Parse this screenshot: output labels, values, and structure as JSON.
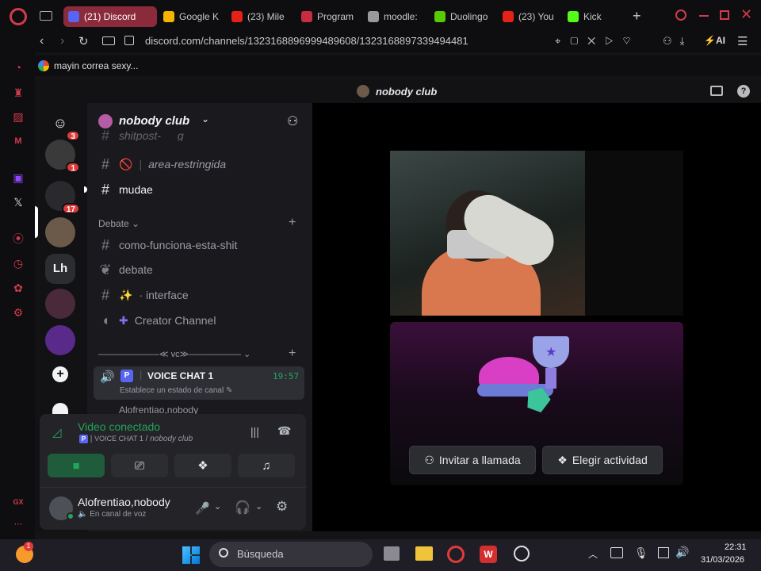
{
  "browser": {
    "tabs": [
      {
        "label": "(21) Discord",
        "icon": "discord-icon",
        "color": "#5865f2",
        "active": true
      },
      {
        "label": "Google K",
        "icon": "keep-icon",
        "color": "#f4b400",
        "active": false
      },
      {
        "label": "(23) Mile",
        "icon": "youtube-icon",
        "color": "#e62117",
        "active": false
      },
      {
        "label": "Program",
        "icon": "opera-icon",
        "color": "#c72c41",
        "active": false
      },
      {
        "label": "moodle:",
        "icon": "moodle-icon",
        "color": "#999999",
        "active": false
      },
      {
        "label": "Duolingo",
        "icon": "duolingo-icon",
        "color": "#58cc02",
        "active": false
      },
      {
        "label": "(23) You",
        "icon": "youtube-icon",
        "color": "#e62117",
        "active": false
      },
      {
        "label": "Kick",
        "icon": "kick-icon",
        "color": "#53fc18",
        "active": false
      }
    ],
    "url": "discord.com/channels/1323168896999489608/1323168897339494481",
    "bookmark": "mayin correa sexy...",
    "ai_label": "AI"
  },
  "discord": {
    "header_title": "nobody club",
    "server_name": "nobody club",
    "servers": [
      {
        "name": "discord-home",
        "badge": "3",
        "color": "#5865f2",
        "text": ""
      },
      {
        "name": "server-avatar-1",
        "badge": "1",
        "color": "#3a3a3a",
        "text": ""
      },
      {
        "name": "server-avatar-2",
        "badge": "17",
        "color": "#2a2a2e",
        "text": ""
      },
      {
        "name": "server-avatar-3",
        "badge": "",
        "color": "#6b5a4a",
        "text": ""
      },
      {
        "name": "server-lh",
        "badge": "",
        "color": "#2b2d31",
        "text": "Lh"
      },
      {
        "name": "server-avatar-5",
        "badge": "",
        "color": "#4a2a3a",
        "text": ""
      },
      {
        "name": "server-avatar-6",
        "badge": "",
        "color": "#5a2a8a",
        "text": ""
      }
    ],
    "channels": {
      "partial_top": "shitpost-゚ﾟg",
      "area": "area-restringida",
      "mudae": "mudae",
      "category_debate": "Debate",
      "como": "como-funciona-esta-shit",
      "debate": "debate",
      "interface": "· interface",
      "creator": "Creator Channel",
      "divider": "———————≪ vc≫——————",
      "voice_name": "VOICE CHAT 1",
      "voice_time": "19:57",
      "voice_status": "Establece un estado de canal",
      "partial_user": "Alofrentiao,nobody"
    },
    "voice_panel": {
      "status": "Video conectado",
      "channel": "VOICE CHAT 1",
      "server": "nobody club",
      "sep": " / ",
      "username": "Alofrentiao,nobody",
      "user_status": "En canal de voz"
    },
    "stage": {
      "invite": "Invitar a llamada",
      "activity": "Elegir actividad"
    }
  },
  "taskbar": {
    "search": "Búsqueda",
    "time": "22:31",
    "date": "31/03/2026",
    "weather_badge": "1"
  },
  "colors": {
    "accent": "#5865f2",
    "opera": "#d33a4a",
    "voice_green": "#23a55a",
    "tab_active": "#8b2a3a"
  }
}
